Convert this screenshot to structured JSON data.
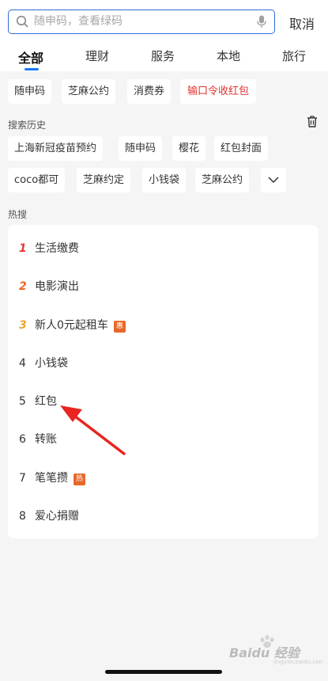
{
  "search": {
    "placeholder": "随申码，查看绿码",
    "value": "",
    "cancel_label": "取消"
  },
  "tabs": [
    {
      "label": "全部",
      "active": true
    },
    {
      "label": "理财",
      "active": false
    },
    {
      "label": "服务",
      "active": false
    },
    {
      "label": "本地",
      "active": false
    },
    {
      "label": "旅行",
      "active": false
    }
  ],
  "suggestions": [
    {
      "label": "随申码"
    },
    {
      "label": "芝麻公约"
    },
    {
      "label": "消费券"
    },
    {
      "label": "输口令收红包",
      "highlight": true
    }
  ],
  "history": {
    "title": "搜索历史",
    "items": [
      {
        "label": "上海新冠疫苗预约"
      },
      {
        "label": "随申码"
      },
      {
        "label": "樱花"
      },
      {
        "label": "红包封面"
      },
      {
        "label": "coco都可"
      },
      {
        "label": "芝麻约定"
      },
      {
        "label": "小钱袋"
      },
      {
        "label": "芝麻公约"
      }
    ]
  },
  "hot": {
    "title": "热搜",
    "items": [
      {
        "rank": "1",
        "label": "生活缴费",
        "tag": ""
      },
      {
        "rank": "2",
        "label": "电影演出",
        "tag": ""
      },
      {
        "rank": "3",
        "label": "新人0元起租车",
        "tag": "惠"
      },
      {
        "rank": "4",
        "label": "小钱袋",
        "tag": ""
      },
      {
        "rank": "5",
        "label": "红包",
        "tag": ""
      },
      {
        "rank": "6",
        "label": "转账",
        "tag": ""
      },
      {
        "rank": "7",
        "label": "笔笔攒",
        "tag": "热"
      },
      {
        "rank": "8",
        "label": "爱心捐赠",
        "tag": ""
      }
    ]
  },
  "colors": {
    "accent": "#1677ff",
    "search_border": "#2f6bd8",
    "highlight_red": "#e5312f",
    "tag_orange": "#e8682a",
    "annotation_red": "#e8251e"
  },
  "watermark": {
    "text": "Baidu 经验",
    "url": "jingyan.baidu.com"
  }
}
